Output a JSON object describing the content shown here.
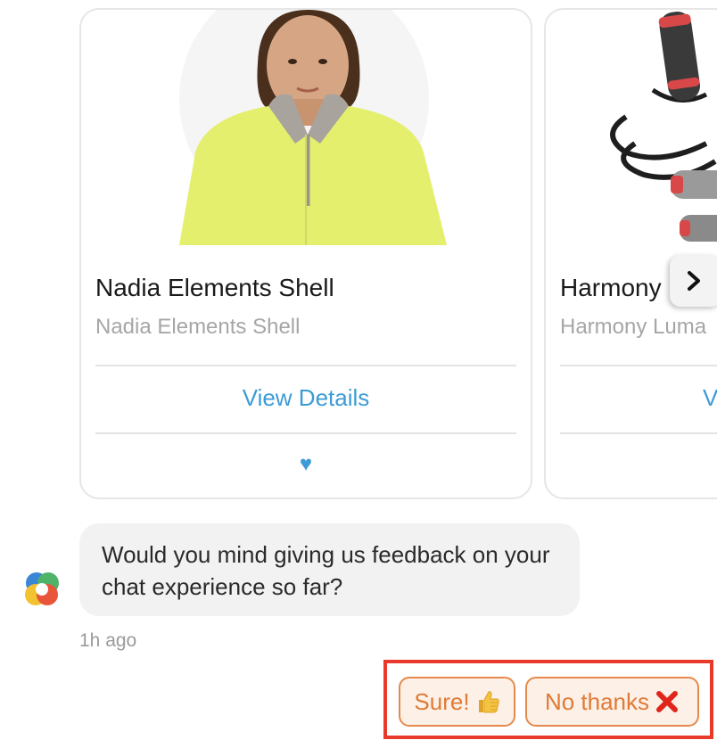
{
  "carousel": {
    "cards": [
      {
        "title": "Nadia Elements Shell",
        "subtitle": "Nadia Elements Shell",
        "action_label": "View Details",
        "favorite_glyph": "♥",
        "image_icon": "product-photo-green-jacket-icon"
      },
      {
        "title": "Harmony",
        "subtitle": "Harmony Luma",
        "action_label": "V",
        "image_icon": "product-photo-jump-rope-icon"
      }
    ],
    "next_icon": "chevron-right-icon"
  },
  "message": {
    "avatar_icon": "bot-logo-icon",
    "text": "Would you mind giving us feedback on your chat experience so far?",
    "timestamp": "1h ago"
  },
  "quick_replies": {
    "sure_label": "Sure!",
    "sure_icon": "thumbs-up-icon",
    "no_label": "No thanks",
    "no_icon": "red-x-icon"
  },
  "colors": {
    "accent": "#3c9bd6",
    "highlight": "#e8392b",
    "quick_reply_text": "#e07a35"
  }
}
